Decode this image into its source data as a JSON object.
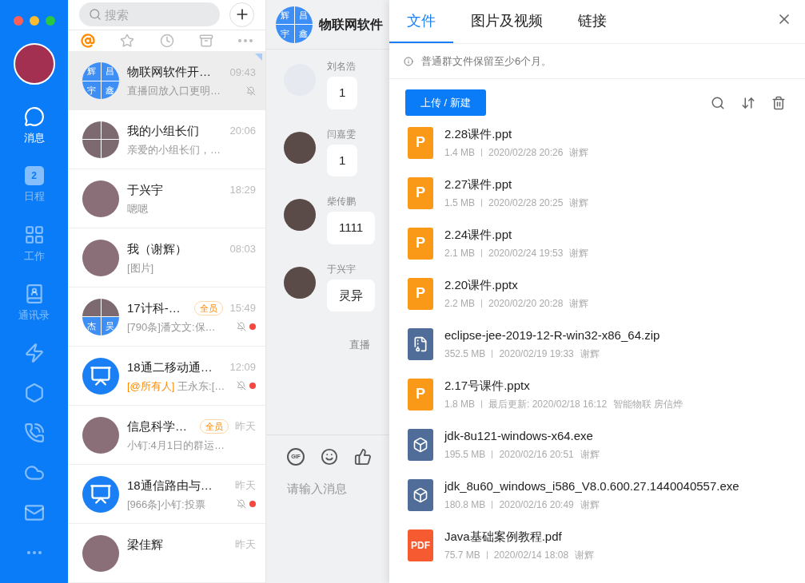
{
  "nav": {
    "items": [
      {
        "label": "消息",
        "selected": true
      },
      {
        "label": "日程",
        "badge": "2",
        "selected": false
      },
      {
        "label": "工作",
        "selected": false
      },
      {
        "label": "通讯录",
        "selected": false
      },
      {
        "selected": false
      },
      {
        "selected": false
      },
      {
        "selected": false
      },
      {
        "selected": false
      },
      {
        "selected": false
      },
      {
        "selected": false
      }
    ]
  },
  "chat_list": {
    "search": {
      "placeholder": "搜索"
    },
    "filters": [
      {
        "selected": true
      },
      {
        "selected": false
      },
      {
        "selected": false
      },
      {
        "selected": false
      },
      {
        "selected": false
      }
    ],
    "items": [
      {
        "name": "物联网软件开…",
        "time": "09:43",
        "preview": "直播回放入口更明…",
        "avatar": {
          "kind": "grid",
          "cells": [
            {
              "kind": "char",
              "char": "辉"
            },
            {
              "kind": "char",
              "char": "昌"
            },
            {
              "kind": "char",
              "char": "宇"
            },
            {
              "kind": "char",
              "char": "鑫"
            }
          ]
        },
        "muted": true,
        "unread": false,
        "pinned": true,
        "selected": true
      },
      {
        "name": "我的小组长们",
        "time": "20:06",
        "preview": "亲爱的小组长们，…",
        "avatar": {
          "kind": "grid",
          "cells": [
            {
              "kind": "photo"
            },
            {
              "kind": "photo"
            },
            {
              "kind": "photo"
            },
            {
              "kind": "photo"
            }
          ]
        },
        "muted": false,
        "unread": false,
        "pinned": false,
        "selected": false
      },
      {
        "name": "于兴宇",
        "time": "18:29",
        "preview": "嗯嗯",
        "avatar": {
          "kind": "photo"
        },
        "muted": false,
        "unread": false,
        "pinned": false,
        "selected": false
      },
      {
        "name": "我（谢辉）",
        "time": "08:03",
        "preview": "[图片]",
        "avatar": {
          "kind": "photo"
        },
        "muted": false,
        "unread": false,
        "pinned": false,
        "selected": false
      },
      {
        "name": "17计科-…",
        "tag": "全员",
        "time": "15:49",
        "preview": "[790条]潘文文:保…",
        "avatar": {
          "kind": "grid",
          "cells": [
            {
              "kind": "photo"
            },
            {
              "kind": "photo"
            },
            {
              "kind": "char",
              "char": "杰"
            },
            {
              "kind": "char",
              "char": "昊"
            }
          ]
        },
        "muted": true,
        "unread": true,
        "pinned": false,
        "selected": false
      },
      {
        "name": "18通二移动通…",
        "time": "12:09",
        "mention": "[@所有人]",
        "preview": "王永东:[…",
        "avatar": {
          "kind": "board"
        },
        "muted": true,
        "unread": true,
        "pinned": false,
        "selected": false
      },
      {
        "name": "信息科学…",
        "tag": "全员",
        "time": "昨天",
        "preview": "小钉:4月1日的群运…",
        "avatar": {
          "kind": "photo"
        },
        "muted": false,
        "unread": false,
        "pinned": false,
        "selected": false
      },
      {
        "name": "18通信路由与…",
        "time": "昨天",
        "preview": "[966条]小钉:投票",
        "avatar": {
          "kind": "board"
        },
        "muted": true,
        "unread": true,
        "pinned": false,
        "selected": false
      },
      {
        "name": "梁佳辉",
        "time": "昨天",
        "avatar": {
          "kind": "photo"
        },
        "muted": false,
        "unread": false,
        "pinned": false,
        "selected": false
      }
    ]
  },
  "chat": {
    "title": "物联网软件",
    "avatar_chars": [
      "辉",
      "昌",
      "宇",
      "鑫"
    ],
    "messages": [
      {
        "sender": "刘名浩",
        "text": "1",
        "has_photo": false
      },
      {
        "sender": "闫嘉雯",
        "text": "1",
        "has_photo": true
      },
      {
        "sender": "柴传鹏",
        "text": "1111",
        "has_photo": true
      },
      {
        "sender": "于兴宇",
        "text": "灵异",
        "has_photo": true
      }
    ],
    "system_note": "直播",
    "toolbar": {
      "gif_label": "GIF"
    },
    "input": {
      "placeholder": "请输入消息"
    }
  },
  "files_panel": {
    "tabs": [
      {
        "label": "文件",
        "selected": true
      },
      {
        "label": "图片及视频",
        "selected": false
      },
      {
        "label": "链接",
        "selected": false
      }
    ],
    "notice": "普通群文件保留至少6个月。",
    "upload_button": "上传 / 新建",
    "files": [
      {
        "kind": "ppt",
        "icon_label": "P",
        "name": "2.28课件.ppt",
        "size": "1.4 MB",
        "info": "2020/02/28 20:26",
        "owner": "谢辉"
      },
      {
        "kind": "ppt",
        "icon_label": "P",
        "name": "2.27课件.ppt",
        "size": "1.5 MB",
        "info": "2020/02/28 20:25",
        "owner": "谢辉"
      },
      {
        "kind": "ppt",
        "icon_label": "P",
        "name": "2.24课件.ppt",
        "size": "2.1 MB",
        "info": "2020/02/24 19:53",
        "owner": "谢辉"
      },
      {
        "kind": "ppt",
        "icon_label": "P",
        "name": "2.20课件.pptx",
        "size": "2.2 MB",
        "info": "2020/02/20 20:28",
        "owner": "谢辉"
      },
      {
        "kind": "zip",
        "name": "eclipse-jee-2019-12-R-win32-x86_64.zip",
        "size": "352.5 MB",
        "info": "2020/02/19 19:33",
        "owner": "谢辉"
      },
      {
        "kind": "ppt",
        "icon_label": "P",
        "name": "2.17号课件.pptx",
        "size": "1.8 MB",
        "info": "最后更新: 2020/02/18 16:12",
        "owner": "智能物联 房信烨"
      },
      {
        "kind": "exe",
        "name": "jdk-8u121-windows-x64.exe",
        "size": "195.5 MB",
        "info": "2020/02/16 20:51",
        "owner": "谢辉"
      },
      {
        "kind": "exe",
        "name": "jdk_8u60_windows_i586_V8.0.600.27.1440040557.exe",
        "size": "180.8 MB",
        "info": "2020/02/16 20:49",
        "owner": "谢辉"
      },
      {
        "kind": "pdf",
        "icon_label": "PDF",
        "name": "Java基础案例教程.pdf",
        "size": "75.7 MB",
        "info": "2020/02/14 18:08",
        "owner": "谢辉"
      }
    ]
  }
}
